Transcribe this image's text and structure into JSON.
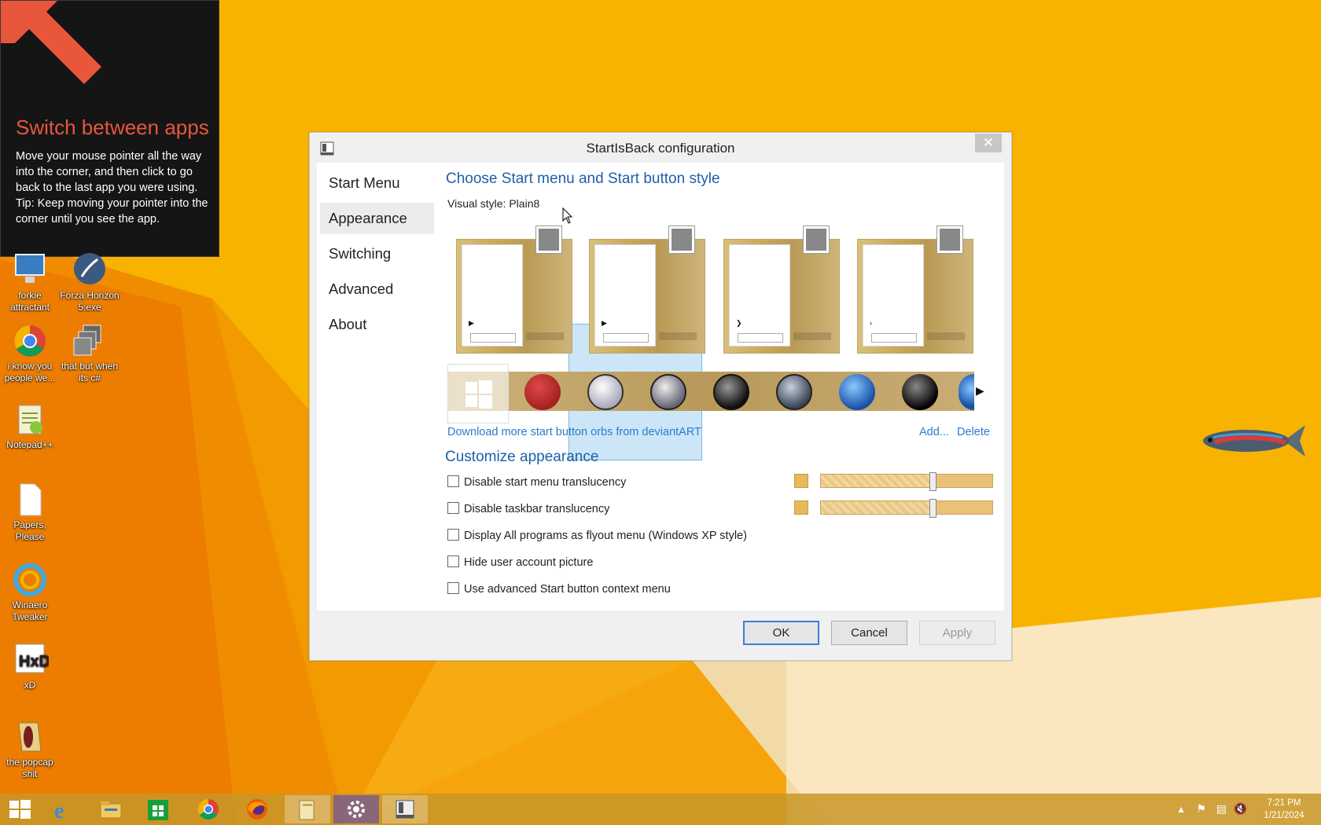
{
  "tip": {
    "title": "Switch between apps",
    "body": "Move your mouse pointer all the way into the corner, and then click to go back to the last app you were using.",
    "tip": "Tip: Keep moving your pointer into the corner until you see the app."
  },
  "desktop_icons": [
    {
      "label": "forkie attractant",
      "icon": "monitor-icon"
    },
    {
      "label": "Forza Horizon 5.exe",
      "icon": "forza-icon"
    },
    {
      "label": "i know you people we...",
      "icon": "chrome-icon"
    },
    {
      "label": "that but when its c#",
      "icon": "stack-icon"
    },
    {
      "label": "Notepad++",
      "icon": "notepad-plus-plus-icon"
    },
    {
      "label": "Papers, Please",
      "icon": "file-icon"
    },
    {
      "label": "Winaero Tweaker",
      "icon": "winaero-icon"
    },
    {
      "label": "xD",
      "icon": "hxd-icon"
    },
    {
      "label": "the popcap shit",
      "icon": "popcap-icon"
    }
  ],
  "dialog": {
    "title": "StartIsBack configuration",
    "close_label": "✕",
    "nav": [
      "Start Menu",
      "Appearance",
      "Switching",
      "Advanced",
      "About"
    ],
    "active_nav": "Appearance",
    "style_section_title": "Choose Start menu and Start button style",
    "visual_style_label": "Visual style:",
    "visual_style_value": "Plain8",
    "selected_preview": 2,
    "download_link": "Download more start button orbs from deviantART",
    "add_link": "Add...",
    "delete_link": "Delete",
    "customize_title": "Customize appearance",
    "options": [
      {
        "label": "Disable start menu translucency",
        "checked": false
      },
      {
        "label": "Disable taskbar translucency",
        "checked": false
      },
      {
        "label": "Display All programs as flyout menu (Windows XP style)",
        "checked": false
      },
      {
        "label": "Hide user account picture",
        "checked": false
      },
      {
        "label": "Use advanced Start button context menu",
        "checked": false
      }
    ],
    "start_menu_translucency_level": 0.65,
    "taskbar_translucency_level": 0.65,
    "swatch_color": "#e7b95a",
    "buttons": {
      "ok": "OK",
      "cancel": "Cancel",
      "apply": "Apply"
    }
  },
  "taskbar": {
    "items": [
      "windows-logo-icon",
      "internet-explorer-icon",
      "file-explorer-icon",
      "store-icon",
      "chrome-icon",
      "firefox-icon",
      "folder-icon",
      "settings-icon",
      "startisback-icon"
    ],
    "clock_time": "7:21 PM",
    "clock_date": "1/21/2024"
  },
  "colors": {
    "accent": "#1f5fa8",
    "link": "#2a7bd1",
    "tip_title": "#e8563c"
  }
}
